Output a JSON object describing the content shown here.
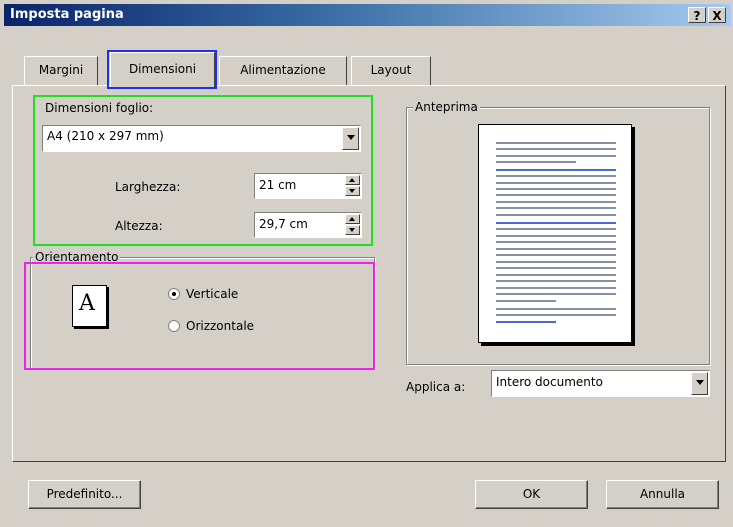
{
  "window": {
    "title": "Imposta pagina",
    "help_button": "?",
    "close_button": "X"
  },
  "tabs": [
    {
      "label": "Margini",
      "active": false
    },
    {
      "label": "Dimensioni",
      "active": true
    },
    {
      "label": "Alimentazione",
      "active": false
    },
    {
      "label": "Layout",
      "active": false
    }
  ],
  "paper_size": {
    "label": "Dimensioni foglio:",
    "value": "A4 (210 x 297 mm)",
    "width_label": "Larghezza:",
    "width_value": "21 cm",
    "height_label": "Altezza:",
    "height_value": "29,7 cm"
  },
  "orientation": {
    "title": "Orientamento",
    "icon_letter": "A",
    "options": [
      {
        "label": "Verticale",
        "checked": true
      },
      {
        "label": "Orizzontale",
        "checked": false
      }
    ]
  },
  "preview": {
    "title": "Anteprima"
  },
  "apply_to": {
    "label": "Applica a:",
    "value": "Intero documento"
  },
  "buttons": {
    "default": "Predefinito...",
    "ok": "OK",
    "cancel": "Annulla"
  },
  "highlights": {
    "tab_color": "#1f2ff0",
    "paper_color": "#22dd22",
    "orientation_color": "#ee22ee"
  }
}
